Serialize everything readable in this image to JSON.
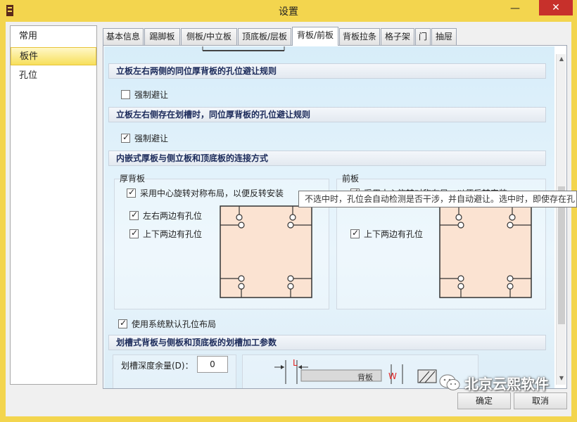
{
  "window": {
    "title": "设置",
    "minimize": "—",
    "close": "✕"
  },
  "nav": {
    "items": [
      {
        "label": "常用"
      },
      {
        "label": "板件"
      },
      {
        "label": "孔位"
      }
    ]
  },
  "tabs": [
    {
      "label": "基本信息"
    },
    {
      "label": "踢脚板"
    },
    {
      "label": "侧板/中立板"
    },
    {
      "label": "顶底板/层板"
    },
    {
      "label": "背板/前板"
    },
    {
      "label": "背板拉条"
    },
    {
      "label": "格子架"
    },
    {
      "label": "门"
    },
    {
      "label": "抽屉"
    }
  ],
  "sections": {
    "s1": "立板左右两侧的同位厚背板的孔位避让规则",
    "s2": "立板左右侧存在划槽时，同位厚背板的孔位避让规则",
    "s3": "内嵌式厚板与侧立板和顶底板的连接方式",
    "s4": "划槽式背板与侧板和顶底板的划槽加工参数"
  },
  "checks": {
    "force_avoid_1": "强制避让",
    "force_avoid_2": "强制避让",
    "rotate_symmetric": "采用中心旋转对称布局，以便反转安装",
    "left_right_holes": "左右两边有孔位",
    "top_bottom_holes": "上下两边有孔位",
    "default_layout": "使用系统默认孔位布局"
  },
  "groups": {
    "thick_back": "厚背板",
    "front": "前板"
  },
  "tooltip": "不选中时，孔位会自动检测是否干涉，并自动避让。选中时，即使存在孔",
  "slot": {
    "depth_label": "划槽深度余量(D)：",
    "depth_value": "0",
    "marker_l": "L",
    "marker_w": "W",
    "back_board": "背板"
  },
  "buttons": {
    "ok": "确定",
    "cancel": "取消"
  },
  "watermark": "北京云熙软件",
  "colors": {
    "accent": "#f3d54e",
    "close": "#c7302b",
    "board": "#fbe3d2"
  }
}
